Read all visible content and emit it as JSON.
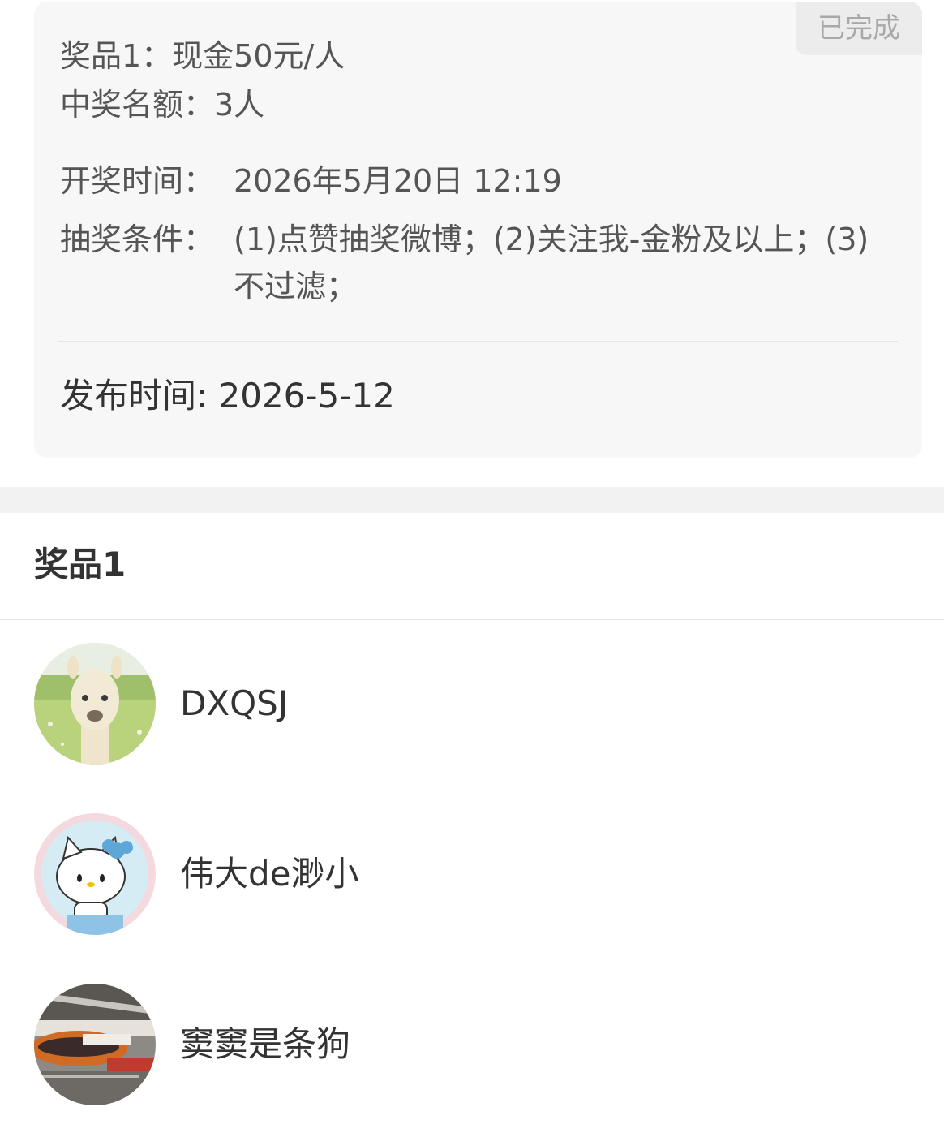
{
  "card": {
    "status": "已完成",
    "prize_line": "奖品1：现金50元/人",
    "quota_line": "中奖名额：3人",
    "draw_time": {
      "label": "开奖时间：",
      "value": "2026年5月20日 12:19"
    },
    "conditions": {
      "label": "抽奖条件：",
      "value": "(1)点赞抽奖微博；(2)关注我-金粉及以上；(3)不过滤；"
    },
    "publish_time": "发布时间: 2026-5-12"
  },
  "section": {
    "title": "奖品1"
  },
  "winners": [
    {
      "name": "DXQSJ",
      "avatar": "alpaca-avatar"
    },
    {
      "name": "伟大de渺小",
      "avatar": "hello-kitty-avatar"
    },
    {
      "name": "窦窦是条狗",
      "avatar": "vehicle-photo-avatar"
    }
  ],
  "colors": {
    "card_bg": "#f7f7f7",
    "badge_bg": "#ececec",
    "badge_text": "#a8a8a8",
    "text": "#333333"
  }
}
